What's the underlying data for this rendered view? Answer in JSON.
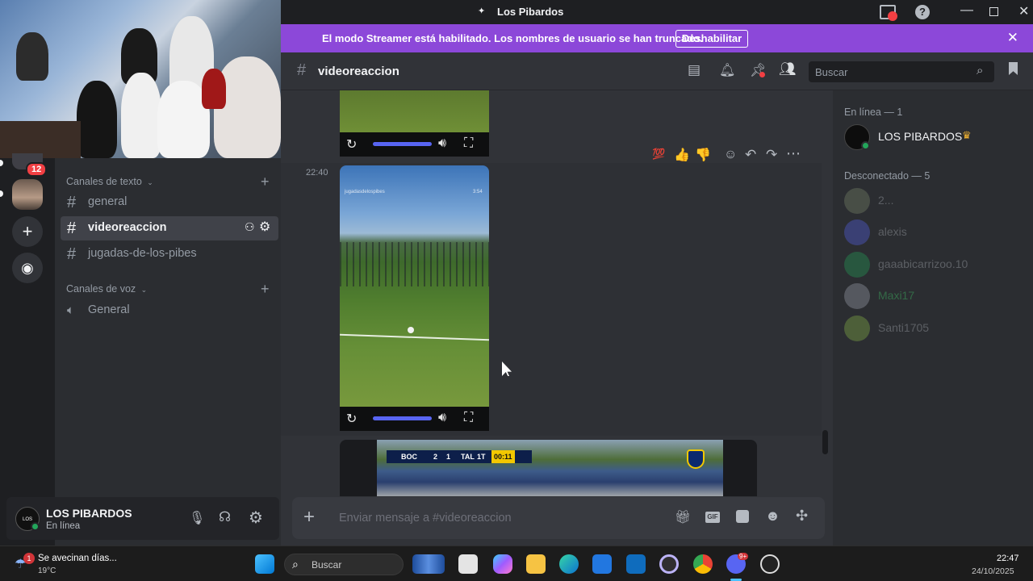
{
  "window": {
    "title": "Los Pibardos"
  },
  "banner": {
    "message": "El modo Streamer está habilitado. Los nombres de usuario se han truncado.",
    "button": "Deshabilitar"
  },
  "rail": {
    "badge": "12"
  },
  "sidebar": {
    "text_category": "Canales de texto",
    "voice_category": "Canales de voz",
    "text_channels": [
      {
        "name": "general"
      },
      {
        "name": "videoreaccion"
      },
      {
        "name": "jugadas-de-los-pibes"
      }
    ],
    "voice_channels": [
      {
        "name": "General"
      }
    ]
  },
  "user": {
    "name": "LOS PIBARDOS",
    "status": "En línea"
  },
  "channel": {
    "name": "videoreaccion"
  },
  "search": {
    "placeholder": "Buscar"
  },
  "messages": {
    "timestamp": "22:40",
    "video_overlay_left": "jugadasdelospibes",
    "video_overlay_right": "3:54"
  },
  "scoreboard": {
    "team1": "BOC",
    "score1": "2",
    "score2": "1",
    "team2": "TAL",
    "period": "1T",
    "clock": "00:11"
  },
  "members": {
    "online_header": "En línea — 1",
    "offline_header": "Desconectado — 5",
    "online": [
      {
        "name": "LOS PIBARDOS",
        "color": "#f2f3f5"
      }
    ],
    "offline": [
      {
        "name": "2...",
        "color": "#6d6f78"
      },
      {
        "name": "alexis",
        "color": "#6d6f78"
      },
      {
        "name": "gaaabicarrizoo.10",
        "color": "#6d6f78"
      },
      {
        "name": "Maxi17",
        "color": "#3ba55c"
      },
      {
        "name": "Santi1705",
        "color": "#6d6f78"
      }
    ]
  },
  "composer": {
    "placeholder": "Enviar mensaje a #videoreaccion"
  },
  "taskbar": {
    "weather_text": "Se avecinan días...",
    "temperature": "19°C",
    "weather_badge": "1",
    "search": "Buscar",
    "time": "22:47",
    "date": "24/10/2025",
    "discord_badge": "9+"
  },
  "colors": {
    "accent": "#5865f2",
    "banner": "#8c48d9",
    "online": "#23a55a"
  }
}
